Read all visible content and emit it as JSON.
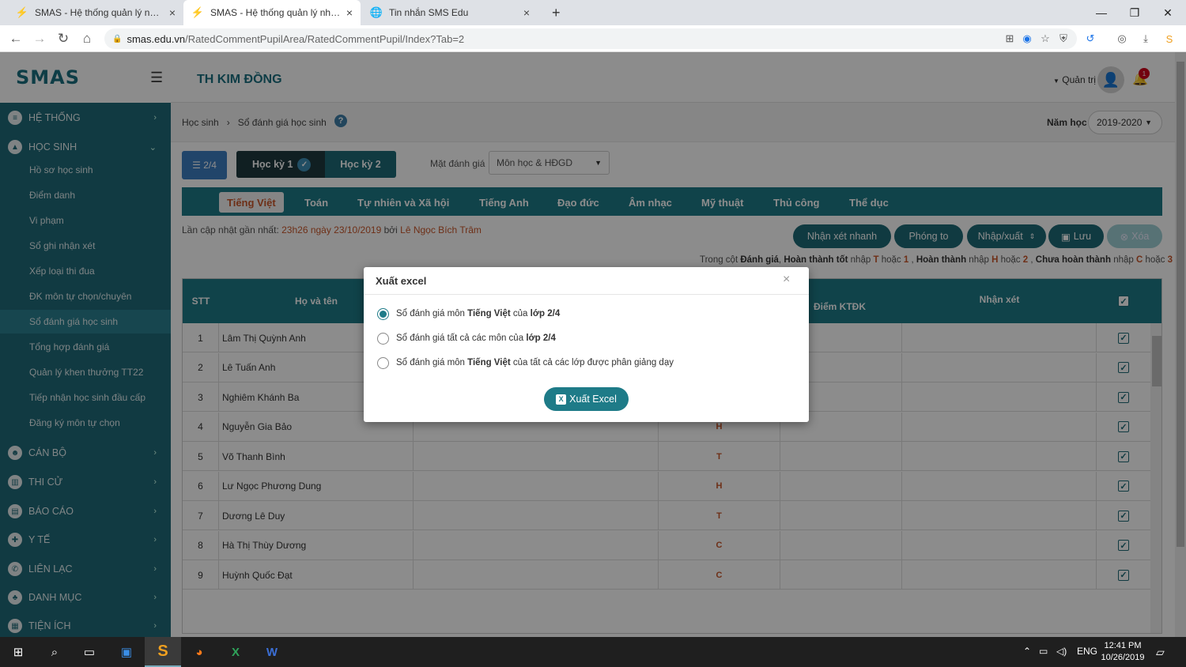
{
  "browser": {
    "tabs": [
      {
        "title": "SMAS - Hệ thống quản lý nhà trư",
        "close": "×"
      },
      {
        "title": "SMAS - Hệ thống quản lý nhà trư",
        "close": "×"
      },
      {
        "title": "Tin nhắn SMS Edu",
        "close": "×"
      }
    ],
    "new_tab": "+",
    "url_domain": "smas.edu.vn",
    "url_path": "/RatedCommentPupilArea/RatedCommentPupil/Index?Tab=2"
  },
  "app": {
    "logo": "SMAS",
    "school": "TH KIM ĐỒNG",
    "user_label": "Quản trị",
    "notification_count": "1"
  },
  "sidebar": {
    "sections_top": [
      {
        "label": "HỆ THỐNG",
        "icon": "database-icon"
      },
      {
        "label": "HỌC SINH",
        "icon": "graduation-cap-icon"
      }
    ],
    "student_items": [
      "Hồ sơ học sinh",
      "Điểm danh",
      "Vi phạm",
      "Sổ ghi nhận xét",
      "Xếp loại thi đua",
      "ĐK môn tự chọn/chuyên",
      "Sổ đánh giá học sinh",
      "Tổng hợp đánh giá",
      "Quản lý khen thưởng TT22",
      "Tiếp nhận học sinh đầu cấp",
      "Đăng ký môn tự chọn"
    ],
    "sections_bottom": [
      {
        "label": "CÁN BỘ",
        "icon": "users-icon"
      },
      {
        "label": "THI CỬ",
        "icon": "chart-icon"
      },
      {
        "label": "BÁO CÁO",
        "icon": "file-icon"
      },
      {
        "label": "Y TẾ",
        "icon": "medkit-icon"
      },
      {
        "label": "LIÊN LẠC",
        "icon": "phone-icon"
      },
      {
        "label": "DANH MỤC",
        "icon": "sitemap-icon"
      },
      {
        "label": "TIỆN ÍCH",
        "icon": "grid-icon"
      }
    ]
  },
  "breadcrumb": {
    "item1": "Học sinh",
    "sep": "›",
    "item2": "Sổ đánh giá học sinh"
  },
  "year": {
    "label": "Năm học",
    "value": "2019-2020"
  },
  "toolbar": {
    "class_btn": "☰ 2/4",
    "sem1": "Học kỳ 1",
    "sem2": "Học kỳ 2",
    "eval_label": "Mặt đánh giá",
    "eval_value": "Môn học & HĐGD"
  },
  "subjects": [
    "Tiếng Việt",
    "Toán",
    "Tự nhiên và Xã hội",
    "Tiếng Anh",
    "Đạo đức",
    "Âm nhạc",
    "Mỹ thuật",
    "Thủ công",
    "Thể dục"
  ],
  "updated": {
    "prefix": "Lần cập nhật gần nhất:",
    "time": "23h26 ngày 23/10/2019",
    "by": "bởi",
    "name": "Lê Ngọc Bích Trâm"
  },
  "actions": {
    "quick": "Nhận xét nhanh",
    "zoom": "Phóng to",
    "io": "Nhập/xuất",
    "save": "Lưu",
    "delete": "Xóa"
  },
  "hint": {
    "p1": "Trong cột",
    "b1": "Đánh giá",
    "p2": ",",
    "b2": "Hoàn thành tốt",
    "p3": "nhập",
    "o1": "T",
    "p4": "hoặc",
    "o2": "1",
    "p5": ",",
    "b3": "Hoàn thành",
    "p6": "nhập",
    "o3": "H",
    "p7": "hoặc",
    "o4": "2",
    "p8": ",",
    "b4": "Chưa hoàn thành",
    "p9": "nhập",
    "o5": "C",
    "p10": "hoặc",
    "o6": "3"
  },
  "table": {
    "headers": {
      "stt": "STT",
      "name": "Họ và tên",
      "score": "Điểm KTĐK",
      "comment": "Nhận xét"
    },
    "rows": [
      {
        "stt": "1",
        "name": "Lâm Thị Quỳnh Anh",
        "mark": ""
      },
      {
        "stt": "2",
        "name": "Lê Tuấn Anh",
        "mark": ""
      },
      {
        "stt": "3",
        "name": "Nghiêm Khánh Ba",
        "mark": ""
      },
      {
        "stt": "4",
        "name": "Nguyễn Gia Bảo",
        "mark": "H"
      },
      {
        "stt": "5",
        "name": "Võ Thanh Bình",
        "mark": "T"
      },
      {
        "stt": "6",
        "name": "Lư Ngọc Phương Dung",
        "mark": "H"
      },
      {
        "stt": "7",
        "name": "Dương Lê Duy",
        "mark": "T"
      },
      {
        "stt": "8",
        "name": "Hà Thị Thùy Dương",
        "mark": "C"
      },
      {
        "stt": "9",
        "name": "Huỳnh Quốc Đạt",
        "mark": "C"
      }
    ]
  },
  "modal": {
    "title": "Xuất excel",
    "close": "×",
    "options": [
      {
        "pre": "Sổ đánh giá môn",
        "b1": "Tiếng Việt",
        "mid": "của",
        "b2": "lớp 2/4",
        "post": ""
      },
      {
        "pre": "Sổ đánh giá tất cả các môn của",
        "b1": "lớp 2/4",
        "mid": "",
        "b2": "",
        "post": ""
      },
      {
        "pre": "Sổ đánh giá môn",
        "b1": "Tiếng Việt",
        "mid": "",
        "b2": "",
        "post": "của tất cả các lớp được phân giảng dạy"
      }
    ],
    "selected": 0,
    "export_btn": "Xuất Excel"
  },
  "taskbar": {
    "lang": "ENG",
    "time": "12:41 PM",
    "date": "10/26/2019"
  },
  "colors": {
    "primary": "#1e7b88",
    "sidebar": "#1f6b78",
    "accent": "#c9572a"
  }
}
